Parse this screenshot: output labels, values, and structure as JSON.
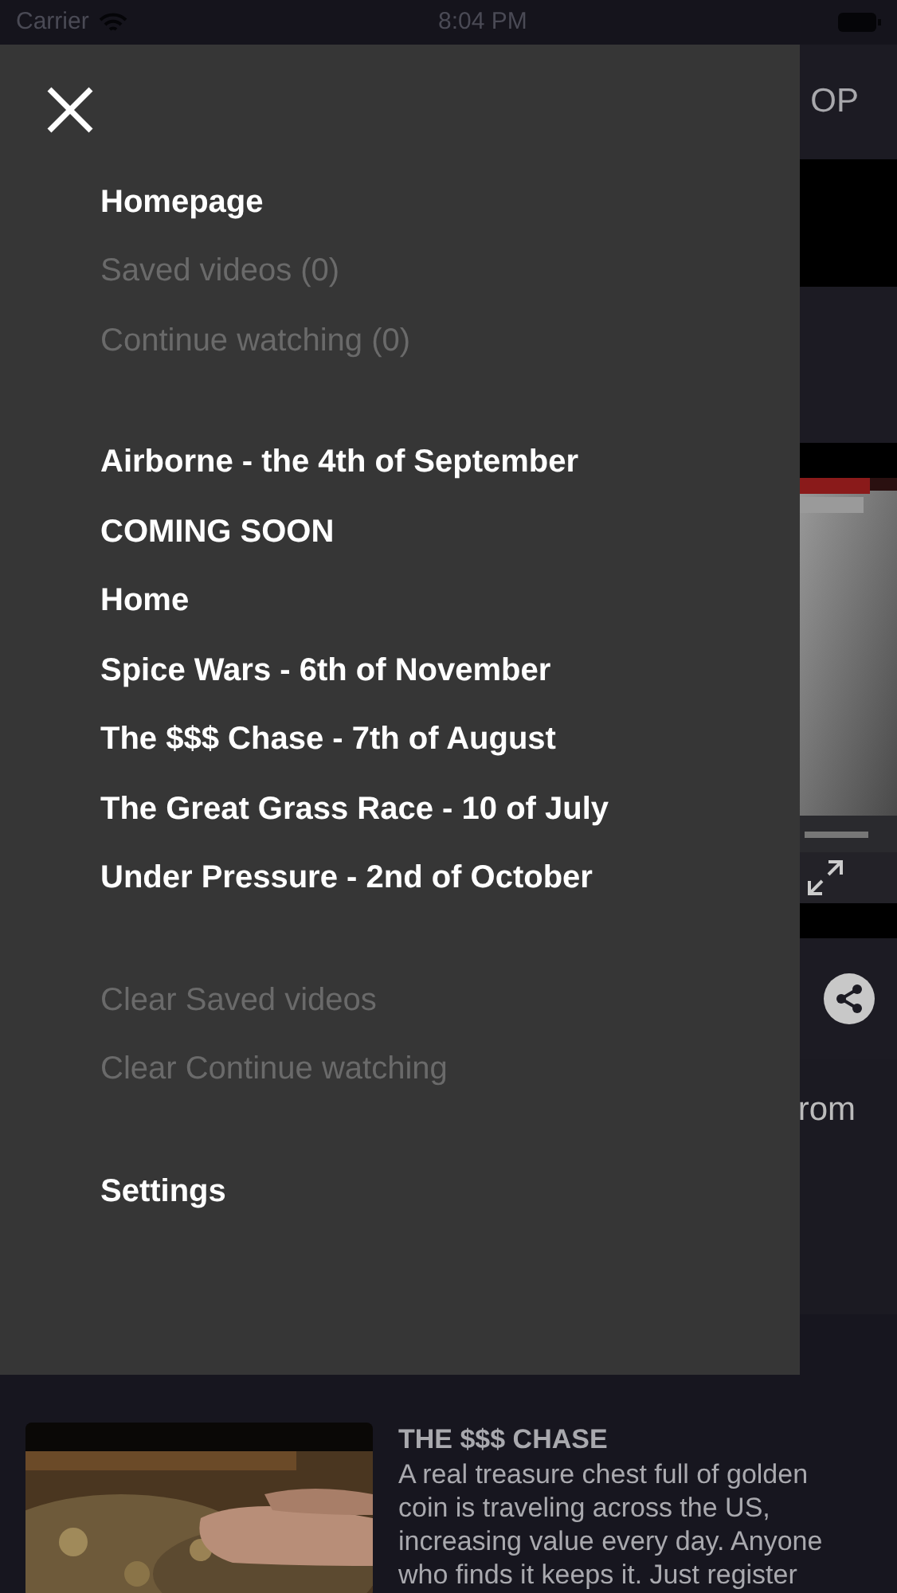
{
  "status_bar": {
    "carrier": "Carrier",
    "time": "8:04 PM"
  },
  "background": {
    "nav_title": "OP",
    "snippet": "rom",
    "card": {
      "title": "THE $$$ CHASE",
      "description": "A real treasure chest full of golden coin is traveling across the US, increasing value every day. Anyone who finds it keeps it. Just register"
    }
  },
  "menu": {
    "sections": [
      {
        "items": [
          {
            "label": "Homepage",
            "disabled": false
          },
          {
            "label": "Saved videos (0)",
            "disabled": true
          },
          {
            "label": "Continue watching (0)",
            "disabled": true
          }
        ]
      },
      {
        "items": [
          {
            "label": "Airborne - the 4th of September",
            "disabled": false
          },
          {
            "label": "COMING SOON",
            "disabled": false
          },
          {
            "label": "Home",
            "disabled": false
          },
          {
            "label": "Spice Wars - 6th of November",
            "disabled": false
          },
          {
            "label": "The $$$ Chase - 7th of August",
            "disabled": false
          },
          {
            "label": "The Great Grass Race - 10 of July",
            "disabled": false
          },
          {
            "label": "Under Pressure - 2nd of October",
            "disabled": false
          }
        ]
      },
      {
        "items": [
          {
            "label": "Clear Saved videos",
            "disabled": true
          },
          {
            "label": "Clear Continue watching",
            "disabled": true
          }
        ]
      },
      {
        "items": [
          {
            "label": "Settings",
            "disabled": false
          }
        ]
      }
    ]
  }
}
